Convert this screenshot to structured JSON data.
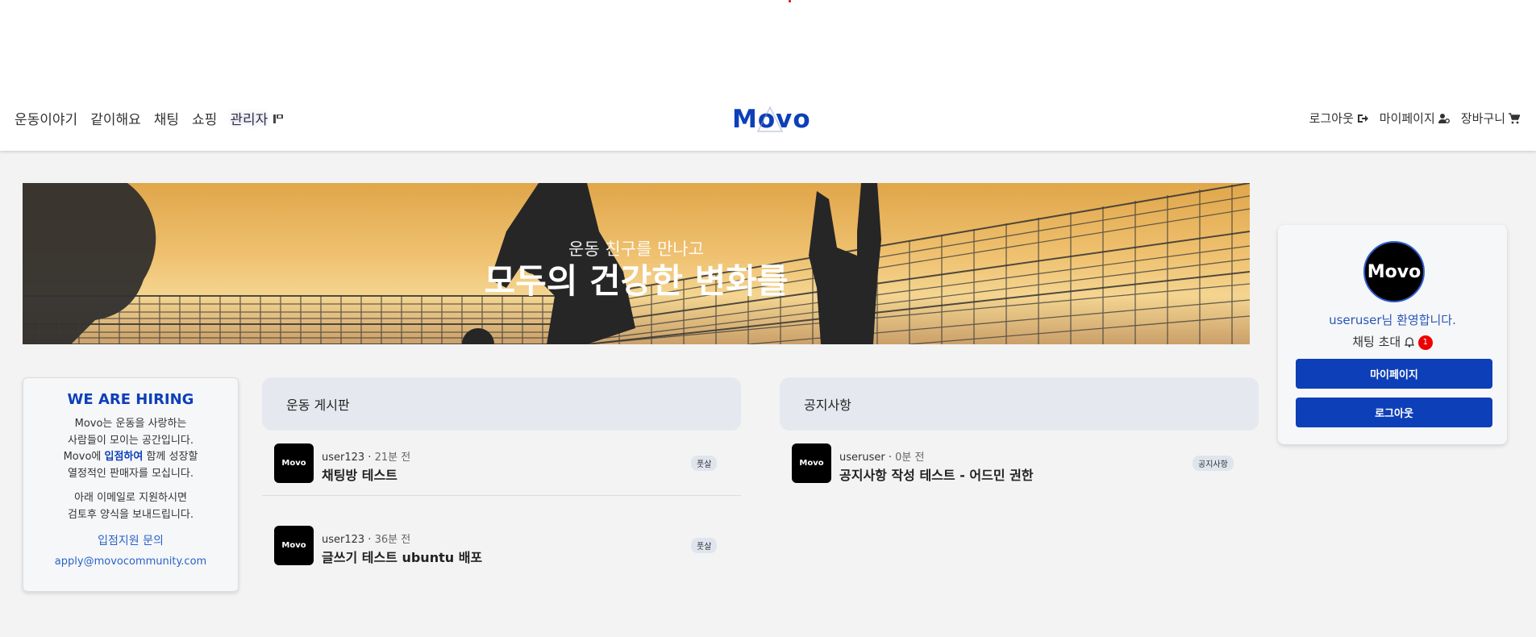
{
  "nav": {
    "left": [
      "운동이야기",
      "같이해요",
      "채팅",
      "쇼핑"
    ],
    "admin_label": "관리자",
    "logo": "Movo",
    "right": {
      "logout": "로그아웃",
      "mypage": "마이페이지",
      "cart": "장바구니"
    }
  },
  "banner": {
    "subtitle": "운동 친구를 만나고",
    "title": "모두의 건강한 변화를"
  },
  "hiring": {
    "title": "WE ARE HIRING",
    "line1": "Movo는 운동을 사랑하는",
    "line2": "사람들이 모이는 공간입니다.",
    "line3_pre": "Movo에 ",
    "line3_hl": "입점하여",
    "line3_post": " 함께 성장할",
    "line4": "열정적인 판매자를 모십니다.",
    "line5": "아래 이메일로 지원하시면",
    "line6": "검토후 양식을 보내드립니다.",
    "link1": "입점지원 문의",
    "link2": "apply@movocommunity.com"
  },
  "exercise_board": {
    "title": "운동 게시판",
    "posts": [
      {
        "thumb": "Movo",
        "user": "user123",
        "time": "21분 전",
        "title": "채팅방 테스트",
        "tag": "풋살"
      },
      {
        "thumb": "Movo",
        "user": "user123",
        "time": "36분 전",
        "title": "글쓰기 테스트 ubuntu 배포",
        "tag": "풋살"
      }
    ]
  },
  "notice_board": {
    "title": "공지사항",
    "posts": [
      {
        "thumb": "Movo",
        "user": "useruser",
        "time": "0분 전",
        "title": "공지사항 작성 테스트 - 어드민 권한",
        "tag": "공지사항"
      }
    ]
  },
  "profile": {
    "avatar": "Movo",
    "welcome": "useruser님 환영합니다.",
    "invite": "채팅 초대",
    "invite_count": "1",
    "btn_mypage": "마이페이지",
    "btn_logout": "로그아웃"
  },
  "colors": {
    "brand": "#0d3fb8",
    "badge": "#ee0000"
  },
  "icons": [
    "key-icon",
    "sign-out-icon",
    "user-gear-icon",
    "cart-icon",
    "bell-icon"
  ]
}
